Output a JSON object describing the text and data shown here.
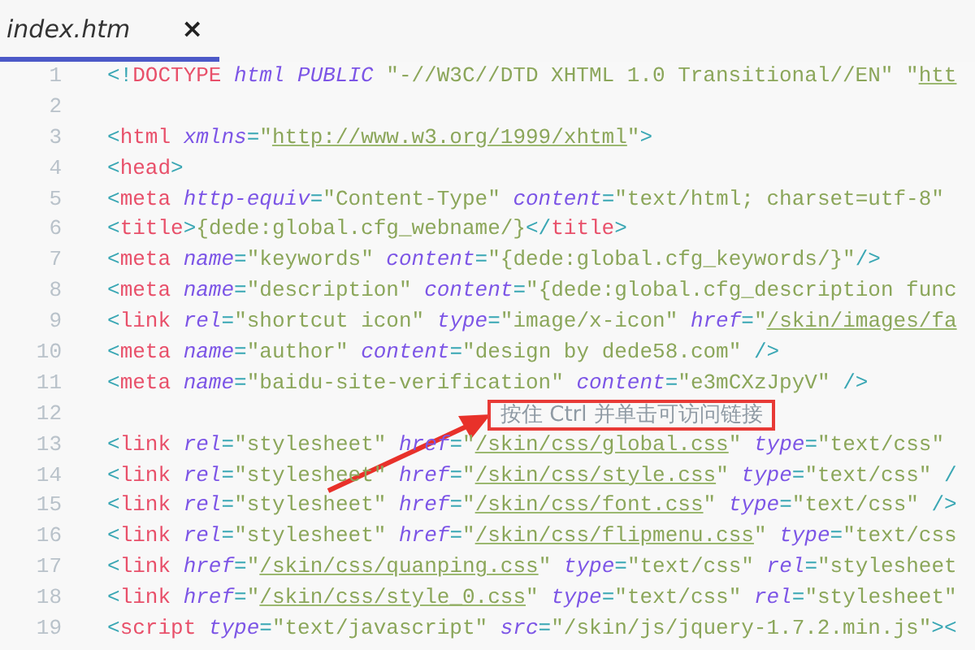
{
  "tabs": [
    {
      "label": "index.htm",
      "selected": true,
      "close": "×"
    }
  ],
  "editor": {
    "lines": [
      {
        "number": "1",
        "tokens": [
          {
            "kind": "punct",
            "text": "<!"
          },
          {
            "kind": "tag",
            "text": "DOCTYPE"
          },
          {
            "kind": "attr",
            "text": " html PUBLIC"
          },
          {
            "kind": "string",
            "text": " \"-//W3C//DTD XHTML 1.0 Transitional//EN\" \""
          },
          {
            "kind": "link",
            "text": "htt"
          }
        ]
      },
      {
        "number": "2"
      },
      {
        "number": "3",
        "tokens": [
          {
            "kind": "punct",
            "text": "<"
          },
          {
            "kind": "tag",
            "text": "html"
          },
          {
            "kind": "attr",
            "text": " xmlns"
          },
          {
            "kind": "punct",
            "text": "="
          },
          {
            "kind": "string",
            "text": "\""
          },
          {
            "kind": "link",
            "text": "http://www.w3.org/1999/xhtml"
          },
          {
            "kind": "string",
            "text": "\""
          },
          {
            "kind": "punct",
            "text": ">"
          }
        ]
      },
      {
        "number": "4",
        "tokens": [
          {
            "kind": "punct",
            "text": "<"
          },
          {
            "kind": "tag",
            "text": "head"
          },
          {
            "kind": "punct",
            "text": ">"
          }
        ]
      },
      {
        "number": "5",
        "tokens": [
          {
            "kind": "punct",
            "text": "<"
          },
          {
            "kind": "tag",
            "text": "meta"
          },
          {
            "kind": "attr",
            "text": " http-equiv"
          },
          {
            "kind": "punct",
            "text": "="
          },
          {
            "kind": "string",
            "text": "\"Content-Type\""
          },
          {
            "kind": "attr",
            "text": " content"
          },
          {
            "kind": "punct",
            "text": "="
          },
          {
            "kind": "string",
            "text": "\"text/html; charset=utf-8\""
          }
        ]
      },
      {
        "number": "6",
        "tokens": [
          {
            "kind": "punct",
            "text": "<"
          },
          {
            "kind": "tag",
            "text": "title"
          },
          {
            "kind": "punct",
            "text": ">"
          },
          {
            "kind": "string",
            "text": "{dede:global.cfg_webname/}"
          },
          {
            "kind": "punct",
            "text": "</"
          },
          {
            "kind": "tag",
            "text": "title"
          },
          {
            "kind": "punct",
            "text": ">"
          }
        ]
      },
      {
        "number": "7",
        "tokens": [
          {
            "kind": "punct",
            "text": "<"
          },
          {
            "kind": "tag",
            "text": "meta"
          },
          {
            "kind": "attr",
            "text": " name"
          },
          {
            "kind": "punct",
            "text": "="
          },
          {
            "kind": "string",
            "text": "\"keywords\""
          },
          {
            "kind": "attr",
            "text": " content"
          },
          {
            "kind": "punct",
            "text": "="
          },
          {
            "kind": "string",
            "text": "\"{dede:global.cfg_keywords/}\""
          },
          {
            "kind": "punct",
            "text": "/>"
          }
        ]
      },
      {
        "number": "8",
        "tokens": [
          {
            "kind": "punct",
            "text": "<"
          },
          {
            "kind": "tag",
            "text": "meta"
          },
          {
            "kind": "attr",
            "text": " name"
          },
          {
            "kind": "punct",
            "text": "="
          },
          {
            "kind": "string",
            "text": "\"description\""
          },
          {
            "kind": "attr",
            "text": " content"
          },
          {
            "kind": "punct",
            "text": "="
          },
          {
            "kind": "string",
            "text": "\"{dede:global.cfg_description func"
          }
        ]
      },
      {
        "number": "9",
        "tokens": [
          {
            "kind": "punct",
            "text": "<"
          },
          {
            "kind": "tag",
            "text": "link"
          },
          {
            "kind": "attr",
            "text": " rel"
          },
          {
            "kind": "punct",
            "text": "="
          },
          {
            "kind": "string",
            "text": "\"shortcut icon\""
          },
          {
            "kind": "attr",
            "text": " type"
          },
          {
            "kind": "punct",
            "text": "="
          },
          {
            "kind": "string",
            "text": "\"image/x-icon\""
          },
          {
            "kind": "attr",
            "text": " href"
          },
          {
            "kind": "punct",
            "text": "="
          },
          {
            "kind": "string",
            "text": "\""
          },
          {
            "kind": "link",
            "text": "/skin/images/fa"
          }
        ]
      },
      {
        "number": "10",
        "tokens": [
          {
            "kind": "punct",
            "text": "<"
          },
          {
            "kind": "tag",
            "text": "meta"
          },
          {
            "kind": "attr",
            "text": " name"
          },
          {
            "kind": "punct",
            "text": "="
          },
          {
            "kind": "string",
            "text": "\"author\""
          },
          {
            "kind": "attr",
            "text": " content"
          },
          {
            "kind": "punct",
            "text": "="
          },
          {
            "kind": "string",
            "text": "\"design by dede58.com\""
          },
          {
            "kind": "punct",
            "text": " />"
          }
        ]
      },
      {
        "number": "11",
        "tokens": [
          {
            "kind": "punct",
            "text": "<"
          },
          {
            "kind": "tag",
            "text": "meta"
          },
          {
            "kind": "attr",
            "text": " name"
          },
          {
            "kind": "punct",
            "text": "="
          },
          {
            "kind": "string",
            "text": "\"baidu-site-verification\""
          },
          {
            "kind": "attr",
            "text": " content"
          },
          {
            "kind": "punct",
            "text": "="
          },
          {
            "kind": "string",
            "text": "\"e3mCXzJpyV\""
          },
          {
            "kind": "punct",
            "text": " />"
          }
        ]
      },
      {
        "number": "12"
      },
      {
        "number": "13",
        "tokens": [
          {
            "kind": "punct",
            "text": "<"
          },
          {
            "kind": "tag",
            "text": "link"
          },
          {
            "kind": "attr",
            "text": " rel"
          },
          {
            "kind": "punct",
            "text": "="
          },
          {
            "kind": "string",
            "text": "\"stylesheet\""
          },
          {
            "kind": "attr",
            "text": " href"
          },
          {
            "kind": "punct",
            "text": "="
          },
          {
            "kind": "string",
            "text": "\""
          },
          {
            "kind": "link",
            "text": "/skin/css/global.css"
          },
          {
            "kind": "string",
            "text": "\""
          },
          {
            "kind": "attr",
            "text": " type"
          },
          {
            "kind": "punct",
            "text": "="
          },
          {
            "kind": "string",
            "text": "\"text/css\""
          }
        ]
      },
      {
        "number": "14",
        "tokens": [
          {
            "kind": "punct",
            "text": "<"
          },
          {
            "kind": "tag",
            "text": "link"
          },
          {
            "kind": "attr",
            "text": " rel"
          },
          {
            "kind": "punct",
            "text": "="
          },
          {
            "kind": "string",
            "text": "\"stylesheet\""
          },
          {
            "kind": "attr",
            "text": " href"
          },
          {
            "kind": "punct",
            "text": "="
          },
          {
            "kind": "string",
            "text": "\""
          },
          {
            "kind": "link",
            "text": "/skin/css/style.css"
          },
          {
            "kind": "string",
            "text": "\""
          },
          {
            "kind": "attr",
            "text": " type"
          },
          {
            "kind": "punct",
            "text": "="
          },
          {
            "kind": "string",
            "text": "\"text/css\""
          },
          {
            "kind": "punct",
            "text": " /"
          }
        ]
      },
      {
        "number": "15",
        "tokens": [
          {
            "kind": "punct",
            "text": "<"
          },
          {
            "kind": "tag",
            "text": "link"
          },
          {
            "kind": "attr",
            "text": " rel"
          },
          {
            "kind": "punct",
            "text": "="
          },
          {
            "kind": "string",
            "text": "\"stylesheet\""
          },
          {
            "kind": "attr",
            "text": " href"
          },
          {
            "kind": "punct",
            "text": "="
          },
          {
            "kind": "string",
            "text": "\""
          },
          {
            "kind": "link",
            "text": "/skin/css/font.css"
          },
          {
            "kind": "string",
            "text": "\""
          },
          {
            "kind": "attr",
            "text": " type"
          },
          {
            "kind": "punct",
            "text": "="
          },
          {
            "kind": "string",
            "text": "\"text/css\""
          },
          {
            "kind": "punct",
            "text": " />"
          }
        ]
      },
      {
        "number": "16",
        "tokens": [
          {
            "kind": "punct",
            "text": "<"
          },
          {
            "kind": "tag",
            "text": "link"
          },
          {
            "kind": "attr",
            "text": " rel"
          },
          {
            "kind": "punct",
            "text": "="
          },
          {
            "kind": "string",
            "text": "\"stylesheet\""
          },
          {
            "kind": "attr",
            "text": " href"
          },
          {
            "kind": "punct",
            "text": "="
          },
          {
            "kind": "string",
            "text": "\""
          },
          {
            "kind": "link",
            "text": "/skin/css/flipmenu.css"
          },
          {
            "kind": "string",
            "text": "\""
          },
          {
            "kind": "attr",
            "text": " type"
          },
          {
            "kind": "punct",
            "text": "="
          },
          {
            "kind": "string",
            "text": "\"text/css"
          }
        ]
      },
      {
        "number": "17",
        "tokens": [
          {
            "kind": "punct",
            "text": "<"
          },
          {
            "kind": "tag",
            "text": "link"
          },
          {
            "kind": "attr",
            "text": " href"
          },
          {
            "kind": "punct",
            "text": "="
          },
          {
            "kind": "string",
            "text": "\""
          },
          {
            "kind": "link",
            "text": "/skin/css/quanping.css"
          },
          {
            "kind": "string",
            "text": "\""
          },
          {
            "kind": "attr",
            "text": " type"
          },
          {
            "kind": "punct",
            "text": "="
          },
          {
            "kind": "string",
            "text": "\"text/css\""
          },
          {
            "kind": "attr",
            "text": " rel"
          },
          {
            "kind": "punct",
            "text": "="
          },
          {
            "kind": "string",
            "text": "\"stylesheet"
          }
        ]
      },
      {
        "number": "18",
        "tokens": [
          {
            "kind": "punct",
            "text": "<"
          },
          {
            "kind": "tag",
            "text": "link"
          },
          {
            "kind": "attr",
            "text": " href"
          },
          {
            "kind": "punct",
            "text": "="
          },
          {
            "kind": "string",
            "text": "\""
          },
          {
            "kind": "link",
            "text": "/skin/css/style_0.css"
          },
          {
            "kind": "string",
            "text": "\""
          },
          {
            "kind": "attr",
            "text": " type"
          },
          {
            "kind": "punct",
            "text": "="
          },
          {
            "kind": "string",
            "text": "\"text/css\""
          },
          {
            "kind": "attr",
            "text": " rel"
          },
          {
            "kind": "punct",
            "text": "="
          },
          {
            "kind": "string",
            "text": "\"stylesheet\""
          }
        ]
      },
      {
        "number": "19",
        "tokens": [
          {
            "kind": "punct",
            "text": "<"
          },
          {
            "kind": "tag",
            "text": "script"
          },
          {
            "kind": "attr",
            "text": " type"
          },
          {
            "kind": "punct",
            "text": "="
          },
          {
            "kind": "string",
            "text": "\"text/javascript\""
          },
          {
            "kind": "attr",
            "text": " src"
          },
          {
            "kind": "punct",
            "text": "="
          },
          {
            "kind": "string",
            "text": "\"/skin/js/jquery-1.7.2.min.js\""
          },
          {
            "kind": "punct",
            "text": "><"
          }
        ]
      }
    ]
  },
  "tooltip": {
    "text": "按住 Ctrl 并单击可访问链接"
  }
}
